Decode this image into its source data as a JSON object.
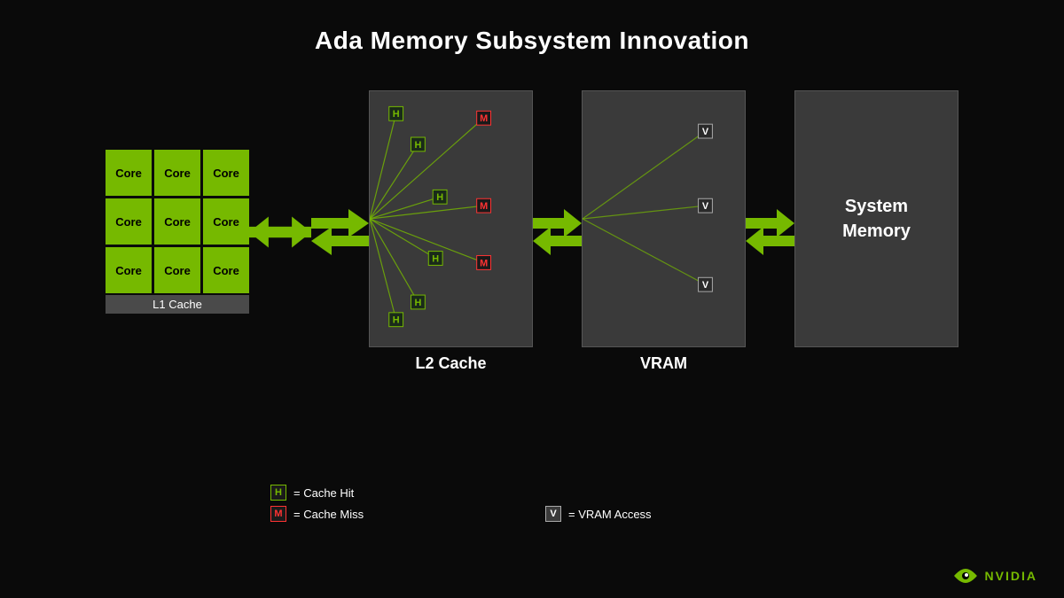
{
  "title": "Ada Memory Subsystem Innovation",
  "cores": {
    "label": "Core",
    "grid_size": 9,
    "l1_label": "L1 Cache"
  },
  "components": {
    "l2": {
      "label": "L2 Cache"
    },
    "vram": {
      "label": "VRAM"
    },
    "system_memory": {
      "label": "System\nMemory"
    }
  },
  "legend": {
    "hit": {
      "badge": "H",
      "text": "= Cache Hit"
    },
    "miss": {
      "badge": "M",
      "text": "= Cache Miss"
    },
    "vram": {
      "badge": "V",
      "text": "= VRAM Access"
    }
  },
  "nvidia": {
    "text": "NVIDIA"
  }
}
